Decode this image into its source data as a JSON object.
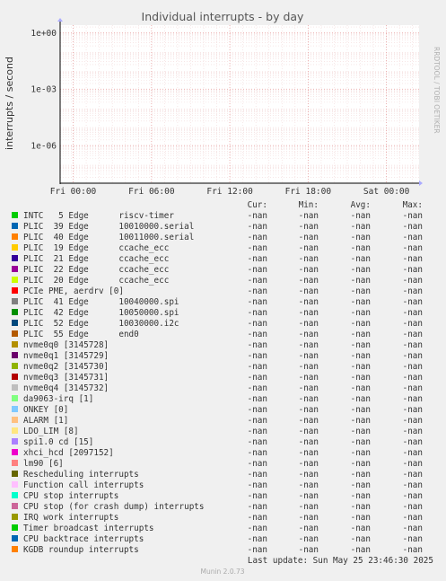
{
  "chart_data": {
    "type": "line",
    "title": "Individual interrupts - by day",
    "ylabel": "interrupts / second",
    "side_text": "RRDTOOL / TOBI OETIKER",
    "y_scale": "log",
    "yticks": [
      "1e+00",
      "1e-03",
      "1e-06"
    ],
    "xticks": [
      "Fri 00:00",
      "Fri 06:00",
      "Fri 12:00",
      "Fri 18:00",
      "Sat 00:00"
    ],
    "grid": true,
    "legend_headers": [
      "Cur:",
      "Min:",
      "Avg:",
      "Max:"
    ],
    "series": [
      {
        "name": "INTC   5 Edge      riscv-timer",
        "color": "#00cc00",
        "cur": "-nan",
        "min": "-nan",
        "avg": "-nan",
        "max": "-nan"
      },
      {
        "name": "PLIC  39 Edge      10010000.serial",
        "color": "#0066b3",
        "cur": "-nan",
        "min": "-nan",
        "avg": "-nan",
        "max": "-nan"
      },
      {
        "name": "PLIC  40 Edge      10011000.serial",
        "color": "#ff8000",
        "cur": "-nan",
        "min": "-nan",
        "avg": "-nan",
        "max": "-nan"
      },
      {
        "name": "PLIC  19 Edge      ccache_ecc",
        "color": "#ffcc00",
        "cur": "-nan",
        "min": "-nan",
        "avg": "-nan",
        "max": "-nan"
      },
      {
        "name": "PLIC  21 Edge      ccache_ecc",
        "color": "#330099",
        "cur": "-nan",
        "min": "-nan",
        "avg": "-nan",
        "max": "-nan"
      },
      {
        "name": "PLIC  22 Edge      ccache_ecc",
        "color": "#990099",
        "cur": "-nan",
        "min": "-nan",
        "avg": "-nan",
        "max": "-nan"
      },
      {
        "name": "PLIC  20 Edge      ccache_ecc",
        "color": "#ccff00",
        "cur": "-nan",
        "min": "-nan",
        "avg": "-nan",
        "max": "-nan"
      },
      {
        "name": "PCIe PME, aerdrv [0]",
        "color": "#ff0000",
        "cur": "-nan",
        "min": "-nan",
        "avg": "-nan",
        "max": "-nan"
      },
      {
        "name": "PLIC  41 Edge      10040000.spi",
        "color": "#808080",
        "cur": "-nan",
        "min": "-nan",
        "avg": "-nan",
        "max": "-nan"
      },
      {
        "name": "PLIC  42 Edge      10050000.spi",
        "color": "#008f00",
        "cur": "-nan",
        "min": "-nan",
        "avg": "-nan",
        "max": "-nan"
      },
      {
        "name": "PLIC  52 Edge      10030000.i2c",
        "color": "#00487d",
        "cur": "-nan",
        "min": "-nan",
        "avg": "-nan",
        "max": "-nan"
      },
      {
        "name": "PLIC  55 Edge      end0",
        "color": "#b35a00",
        "cur": "-nan",
        "min": "-nan",
        "avg": "-nan",
        "max": "-nan"
      },
      {
        "name": "nvme0q0 [3145728]",
        "color": "#b38f00",
        "cur": "-nan",
        "min": "-nan",
        "avg": "-nan",
        "max": "-nan"
      },
      {
        "name": "nvme0q1 [3145729]",
        "color": "#6b006b",
        "cur": "-nan",
        "min": "-nan",
        "avg": "-nan",
        "max": "-nan"
      },
      {
        "name": "nvme0q2 [3145730]",
        "color": "#8fb300",
        "cur": "-nan",
        "min": "-nan",
        "avg": "-nan",
        "max": "-nan"
      },
      {
        "name": "nvme0q3 [3145731]",
        "color": "#b30000",
        "cur": "-nan",
        "min": "-nan",
        "avg": "-nan",
        "max": "-nan"
      },
      {
        "name": "nvme0q4 [3145732]",
        "color": "#bebebe",
        "cur": "-nan",
        "min": "-nan",
        "avg": "-nan",
        "max": "-nan"
      },
      {
        "name": "da9063-irq [1]",
        "color": "#80ff80",
        "cur": "-nan",
        "min": "-nan",
        "avg": "-nan",
        "max": "-nan"
      },
      {
        "name": "ONKEY [0]",
        "color": "#80c9ff",
        "cur": "-nan",
        "min": "-nan",
        "avg": "-nan",
        "max": "-nan"
      },
      {
        "name": "ALARM [1]",
        "color": "#ffc080",
        "cur": "-nan",
        "min": "-nan",
        "avg": "-nan",
        "max": "-nan"
      },
      {
        "name": "LDO_LIM [8]",
        "color": "#ffe680",
        "cur": "-nan",
        "min": "-nan",
        "avg": "-nan",
        "max": "-nan"
      },
      {
        "name": "spi1.0 cd [15]",
        "color": "#aa80ff",
        "cur": "-nan",
        "min": "-nan",
        "avg": "-nan",
        "max": "-nan"
      },
      {
        "name": "xhci_hcd [2097152]",
        "color": "#ee00cc",
        "cur": "-nan",
        "min": "-nan",
        "avg": "-nan",
        "max": "-nan"
      },
      {
        "name": "lm90 [6]",
        "color": "#ff8080",
        "cur": "-nan",
        "min": "-nan",
        "avg": "-nan",
        "max": "-nan"
      },
      {
        "name": "Rescheduling interrupts",
        "color": "#666600",
        "cur": "-nan",
        "min": "-nan",
        "avg": "-nan",
        "max": "-nan"
      },
      {
        "name": "Function call interrupts",
        "color": "#ffbfff",
        "cur": "-nan",
        "min": "-nan",
        "avg": "-nan",
        "max": "-nan"
      },
      {
        "name": "CPU stop interrupts",
        "color": "#00ffcc",
        "cur": "-nan",
        "min": "-nan",
        "avg": "-nan",
        "max": "-nan"
      },
      {
        "name": "CPU stop (for crash dump) interrupts",
        "color": "#cc6699",
        "cur": "-nan",
        "min": "-nan",
        "avg": "-nan",
        "max": "-nan"
      },
      {
        "name": "IRQ work interrupts",
        "color": "#999900",
        "cur": "-nan",
        "min": "-nan",
        "avg": "-nan",
        "max": "-nan"
      },
      {
        "name": "Timer broadcast interrupts",
        "color": "#00cc00",
        "cur": "-nan",
        "min": "-nan",
        "avg": "-nan",
        "max": "-nan"
      },
      {
        "name": "CPU backtrace interrupts",
        "color": "#0066b3",
        "cur": "-nan",
        "min": "-nan",
        "avg": "-nan",
        "max": "-nan"
      },
      {
        "name": "KGDB roundup interrupts",
        "color": "#ff8000",
        "cur": "-nan",
        "min": "-nan",
        "avg": "-nan",
        "max": "-nan"
      }
    ],
    "last_update": "Last update: Sun May 25 23:46:30 2025",
    "footer": "Munin 2.0.73"
  }
}
